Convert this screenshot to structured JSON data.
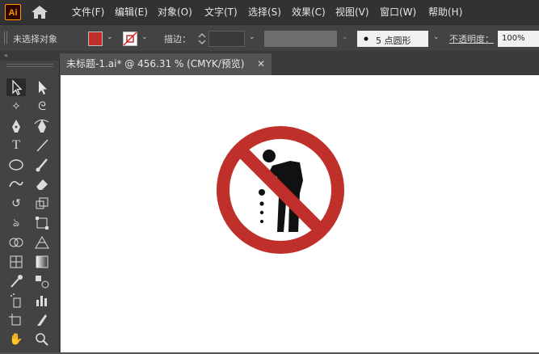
{
  "app": {
    "logo_text": "Ai",
    "brand_color": "#ff9a00"
  },
  "menu": {
    "items": [
      "文件(F)",
      "编辑(E)",
      "对象(O)",
      "文字(T)",
      "选择(S)",
      "效果(C)",
      "视图(V)",
      "窗口(W)",
      "帮助(H)"
    ]
  },
  "control_bar": {
    "selection_status": "未选择对象",
    "fill_color": "#c0302b",
    "stroke_label": "描边：",
    "brush_value": "5 点圆形",
    "opacity_label": "不透明度：",
    "opacity_value": "100%"
  },
  "document": {
    "tab_title": "未标题-1.ai* @ 456.31 % (CMYK/预览)"
  },
  "toolbar": {
    "tools": [
      "selection-tool",
      "direct-selection-tool",
      "magic-wand-tool",
      "lasso-tool",
      "pen-tool",
      "curvature-tool",
      "type-tool",
      "line-tool",
      "ellipse-tool",
      "paintbrush-tool",
      "shaper-tool",
      "eraser-tool",
      "rotate-tool",
      "scale-tool",
      "warp-tool",
      "free-transform-tool",
      "shape-builder-tool",
      "perspective-grid-tool",
      "mesh-tool",
      "gradient-tool",
      "eyedropper-tool",
      "blend-tool",
      "symbol-sprayer-tool",
      "column-graph-tool",
      "artboard-tool",
      "slice-tool",
      "hand-tool",
      "zoom-tool"
    ]
  },
  "artwork": {
    "sign_color": "#c0302b",
    "figure_color": "#111111"
  }
}
